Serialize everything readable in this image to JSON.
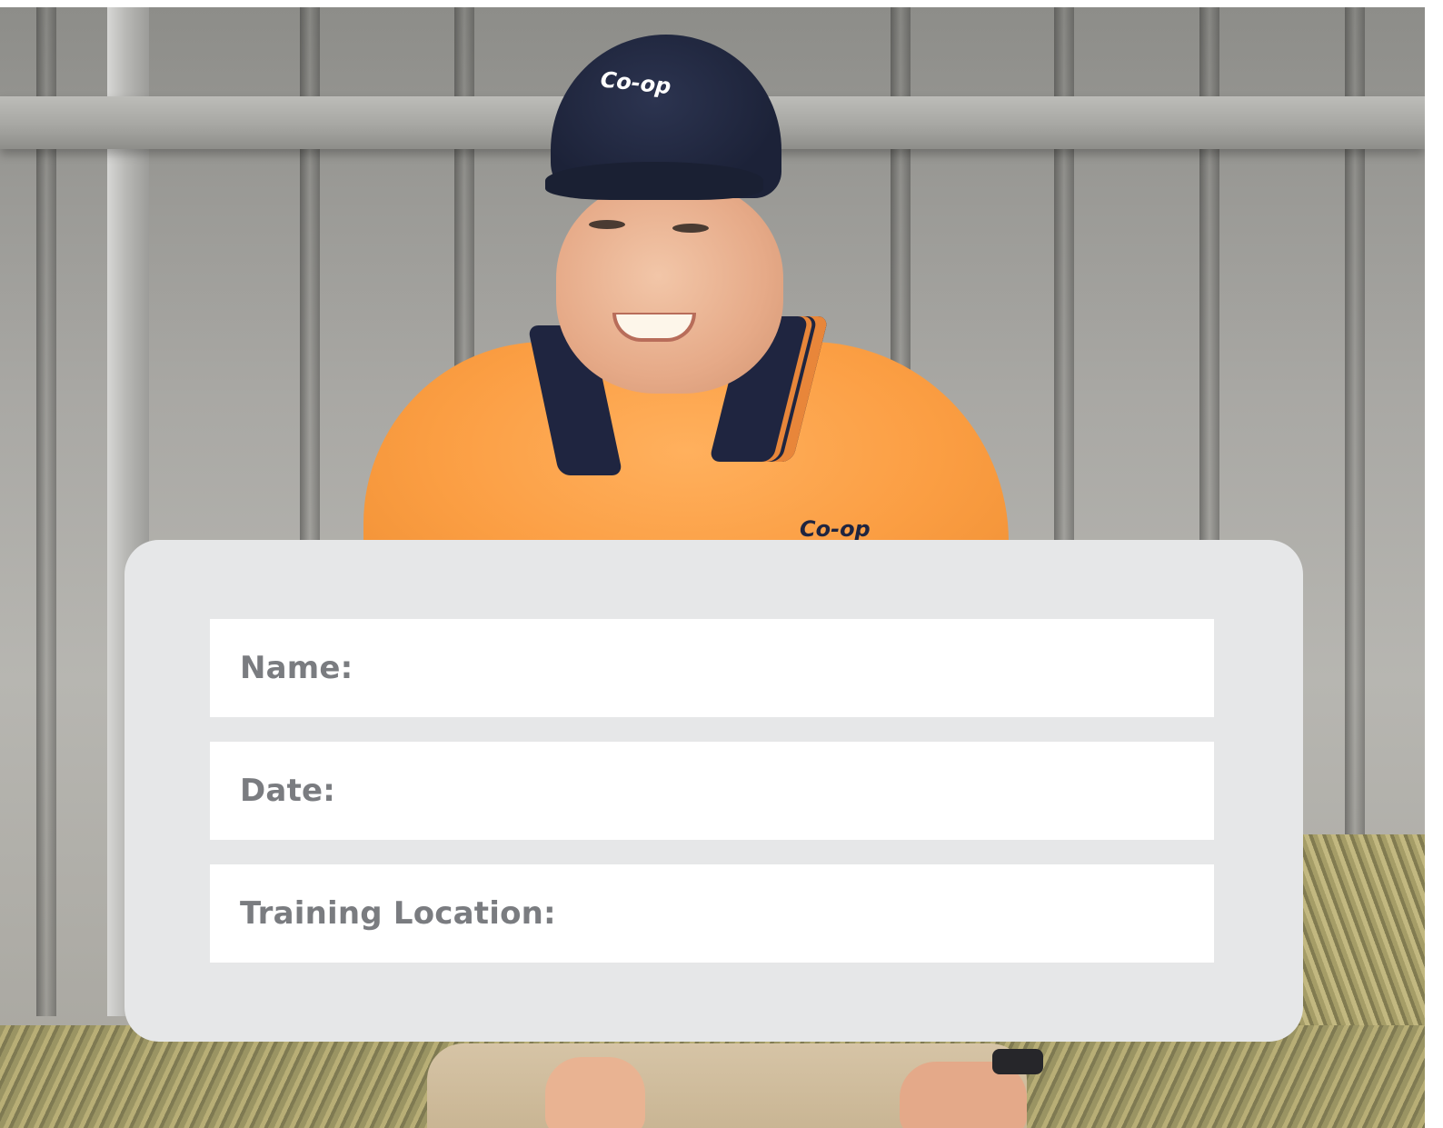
{
  "form": {
    "fields": [
      {
        "label": "Name:"
      },
      {
        "label": "Date:"
      },
      {
        "label": "Training Location:"
      }
    ]
  },
  "photo": {
    "cap_logo_text": "Co-op",
    "shirt_logo_text": "Co-op"
  },
  "colors": {
    "card_background": "#e6e7e8",
    "field_background": "#ffffff",
    "label_text": "#7a7c80",
    "shirt_orange": "#fb9e43",
    "navy": "#1f2540"
  }
}
